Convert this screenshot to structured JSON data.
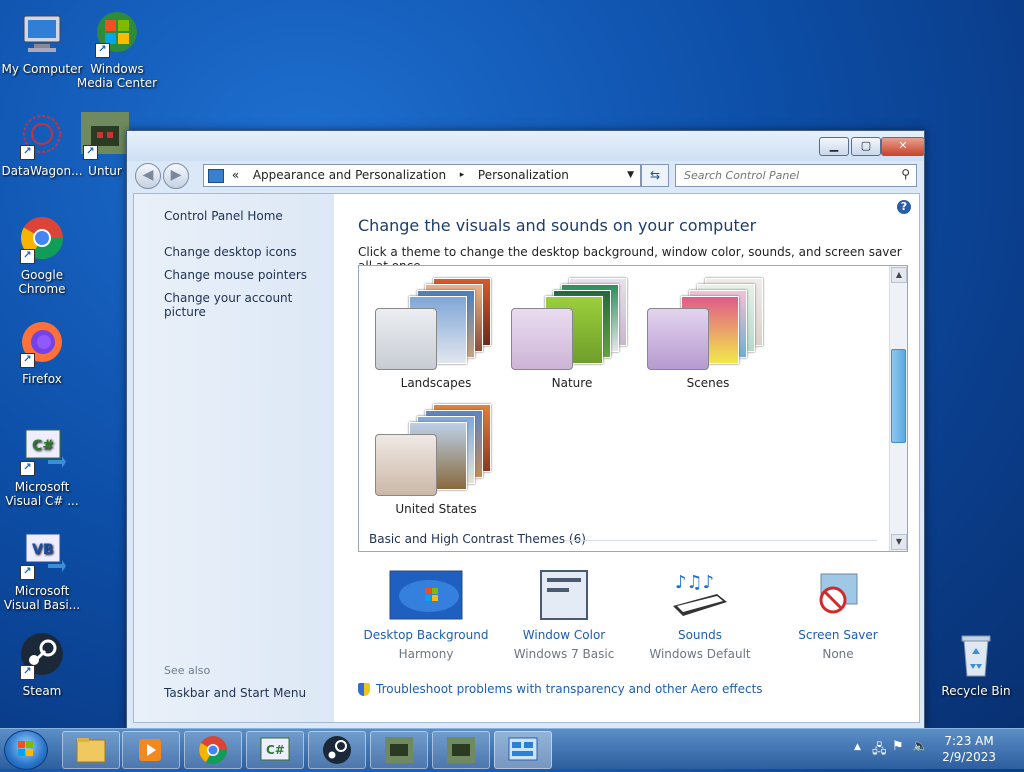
{
  "desktop": {
    "icons": [
      {
        "label": "My Computer"
      },
      {
        "label": "Windows Media Center"
      },
      {
        "label": "DataWagon..."
      },
      {
        "label": "Untur"
      },
      {
        "label": "Google Chrome"
      },
      {
        "label": "Firefox"
      },
      {
        "label": "Microsoft Visual C# ..."
      },
      {
        "label": "Microsoft Visual Basi..."
      },
      {
        "label": "Steam"
      },
      {
        "label": "Recycle Bin"
      }
    ]
  },
  "window": {
    "title_buttons": {
      "minimize": "▁",
      "maximize": "▢",
      "close": "✕"
    },
    "breadcrumb": {
      "prefix": "«",
      "items": [
        "Appearance and Personalization",
        "Personalization"
      ],
      "separator": "▸"
    },
    "search_placeholder": "Search Control Panel"
  },
  "left_pane": {
    "home": "Control Panel Home",
    "links": [
      "Change desktop icons",
      "Change mouse pointers",
      "Change your account picture"
    ],
    "see_also_label": "See also",
    "see_also_links": [
      "Taskbar and Start Menu"
    ]
  },
  "main": {
    "heading": "Change the visuals and sounds on your computer",
    "subheading": "Click a theme to change the desktop background, window color, sounds, and screen saver all at once.",
    "themes": [
      {
        "name": "Landscapes"
      },
      {
        "name": "Nature"
      },
      {
        "name": "Scenes"
      },
      {
        "name": "United States"
      }
    ],
    "section_basic": "Basic and High Contrast Themes (6)",
    "bottom_items": [
      {
        "title": "Desktop Background",
        "value": "Harmony",
        "icon": "desktop-background-icon"
      },
      {
        "title": "Window Color",
        "value": "Windows 7 Basic",
        "icon": "window-color-icon"
      },
      {
        "title": "Sounds",
        "value": "Windows Default",
        "icon": "sounds-icon"
      },
      {
        "title": "Screen Saver",
        "value": "None",
        "icon": "screen-saver-icon"
      }
    ],
    "troubleshoot": "Troubleshoot problems with transparency and other Aero effects"
  },
  "taskbar": {
    "time": "7:23 AM",
    "date": "2/9/2023"
  }
}
